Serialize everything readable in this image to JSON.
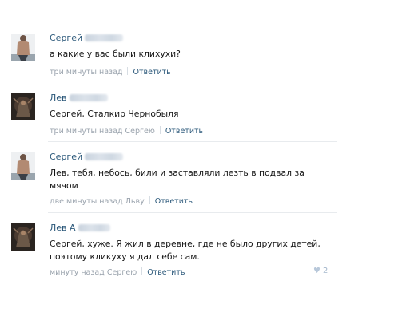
{
  "comments": [
    {
      "author": "Сергей",
      "text": "а какие у вас были клихухи?",
      "time": "три минуты назад",
      "reply_label": "Ответить"
    },
    {
      "author": "Лев",
      "text": "Сергей, Сталкир Чернобыля",
      "time": "три минуты назад Сергею",
      "reply_label": "Ответить"
    },
    {
      "author": "Сергей",
      "text": "Лев, тебя, небось, били и заставляли лезть в подвал за мячом",
      "time": "две минуты назад Льву",
      "reply_label": "Ответить"
    },
    {
      "author": "Лев А",
      "text": "Сергей, хуже. Я жил в деревне, где не было других детей, поэтому кликуху я дал себе сам.",
      "time": "минуту назад Сергею",
      "reply_label": "Ответить",
      "likes": "2"
    }
  ],
  "icons": {
    "like": "heart-icon"
  },
  "colors": {
    "link": "#2b587a",
    "meta": "#9aa3ad",
    "text": "#141414",
    "divider": "#e8ebee"
  }
}
